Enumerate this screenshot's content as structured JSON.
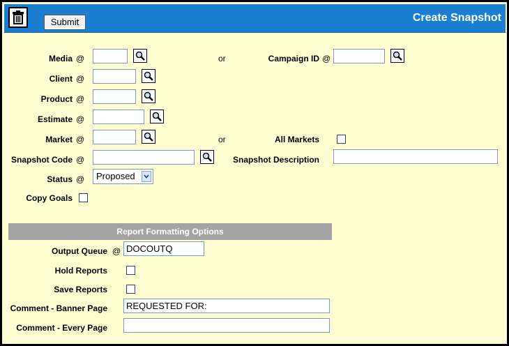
{
  "header": {
    "submit_label": "Submit",
    "title": "Create Snapshot",
    "accent_color": "#1a7fd0"
  },
  "form": {
    "at_symbol": "@",
    "or_text": "or",
    "media_label": "Media",
    "campaign_id_label": "Campaign ID",
    "client_label": "Client",
    "product_label": "Product",
    "estimate_label": "Estimate",
    "market_label": "Market",
    "all_markets_label": "All Markets",
    "snapshot_code_label": "Snapshot Code",
    "snapshot_description_label": "Snapshot Description",
    "status_label": "Status",
    "status_value": "Proposed",
    "copy_goals_label": "Copy Goals"
  },
  "report": {
    "section_title": "Report Formatting Options",
    "output_queue_label": "Output Queue",
    "output_queue_value": "DOCOUTQ",
    "hold_reports_label": "Hold Reports",
    "save_reports_label": "Save Reports",
    "comment_banner_label": "Comment - Banner Page",
    "comment_banner_value": "REQUESTED FOR:",
    "comment_every_label": "Comment - Every Page",
    "comment_every_value": ""
  },
  "icons": {
    "delete": "trash-icon",
    "lookup": "magnifier-icon",
    "dropdown": "chevron-down-icon"
  }
}
